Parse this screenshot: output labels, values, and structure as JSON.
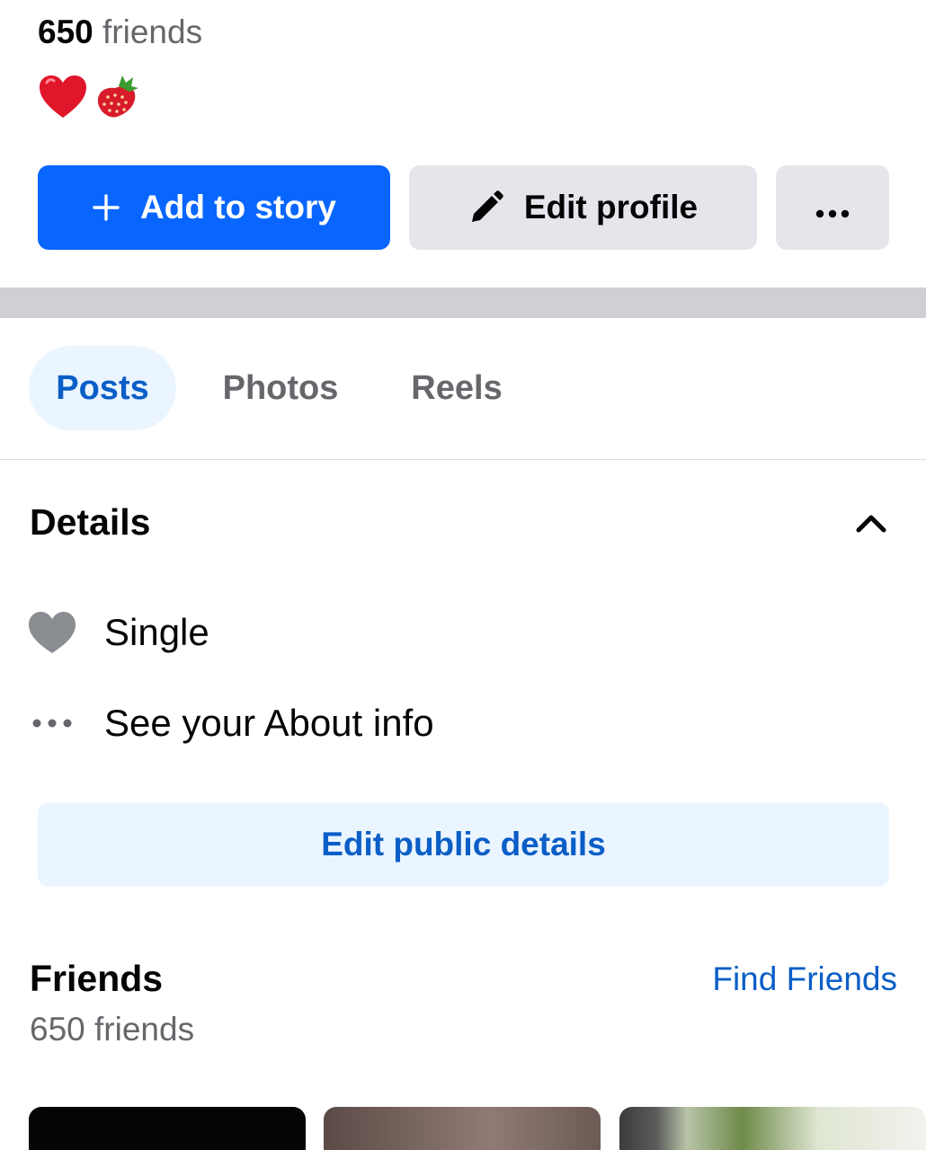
{
  "profile": {
    "friends_count": "650",
    "friends_label": "friends"
  },
  "bio": {
    "emojis": [
      "heart-emoji",
      "strawberry-emoji"
    ]
  },
  "actions": {
    "add_story_label": "Add to story",
    "edit_profile_label": "Edit profile",
    "more_icon": "ellipsis-icon"
  },
  "tabs": [
    {
      "label": "Posts",
      "active": true
    },
    {
      "label": "Photos",
      "active": false
    },
    {
      "label": "Reels",
      "active": false
    }
  ],
  "details": {
    "title": "Details",
    "rows": [
      {
        "icon": "heart-icon",
        "text": "Single"
      },
      {
        "icon": "ellipsis-icon",
        "text": "See your About info"
      }
    ],
    "edit_public_label": "Edit public details"
  },
  "friends": {
    "title": "Friends",
    "link": "Find Friends",
    "subtitle": "650 friends"
  },
  "colors": {
    "primary": "#0866ff",
    "link": "#0a5ec7",
    "secondary_button": "#e4e6eb",
    "active_tab_bg": "#ebf5ff",
    "muted_text": "#65676b"
  }
}
